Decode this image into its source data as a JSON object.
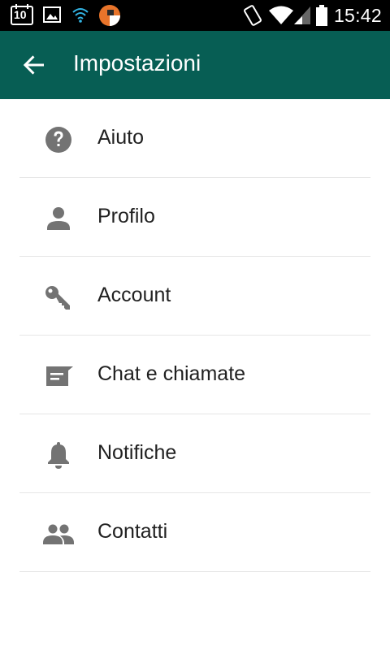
{
  "status_bar": {
    "calendar_day": "10",
    "time": "15:42",
    "icons": [
      "calendar-icon",
      "image-icon",
      "wifi-signal-icon",
      "app-notification-icon",
      "vibrate-icon",
      "wifi-icon",
      "cell-signal-icon",
      "battery-icon"
    ]
  },
  "toolbar": {
    "title": "Impostazioni",
    "back_icon": "arrow-back-icon",
    "color": "#075e54"
  },
  "settings": {
    "items": [
      {
        "label": "Aiuto",
        "icon": "help-icon"
      },
      {
        "label": "Profilo",
        "icon": "person-icon"
      },
      {
        "label": "Account",
        "icon": "key-icon"
      },
      {
        "label": "Chat e chiamate",
        "icon": "chat-icon"
      },
      {
        "label": "Notifiche",
        "icon": "bell-icon"
      },
      {
        "label": "Contatti",
        "icon": "people-icon"
      }
    ],
    "icon_color": "#737373"
  }
}
